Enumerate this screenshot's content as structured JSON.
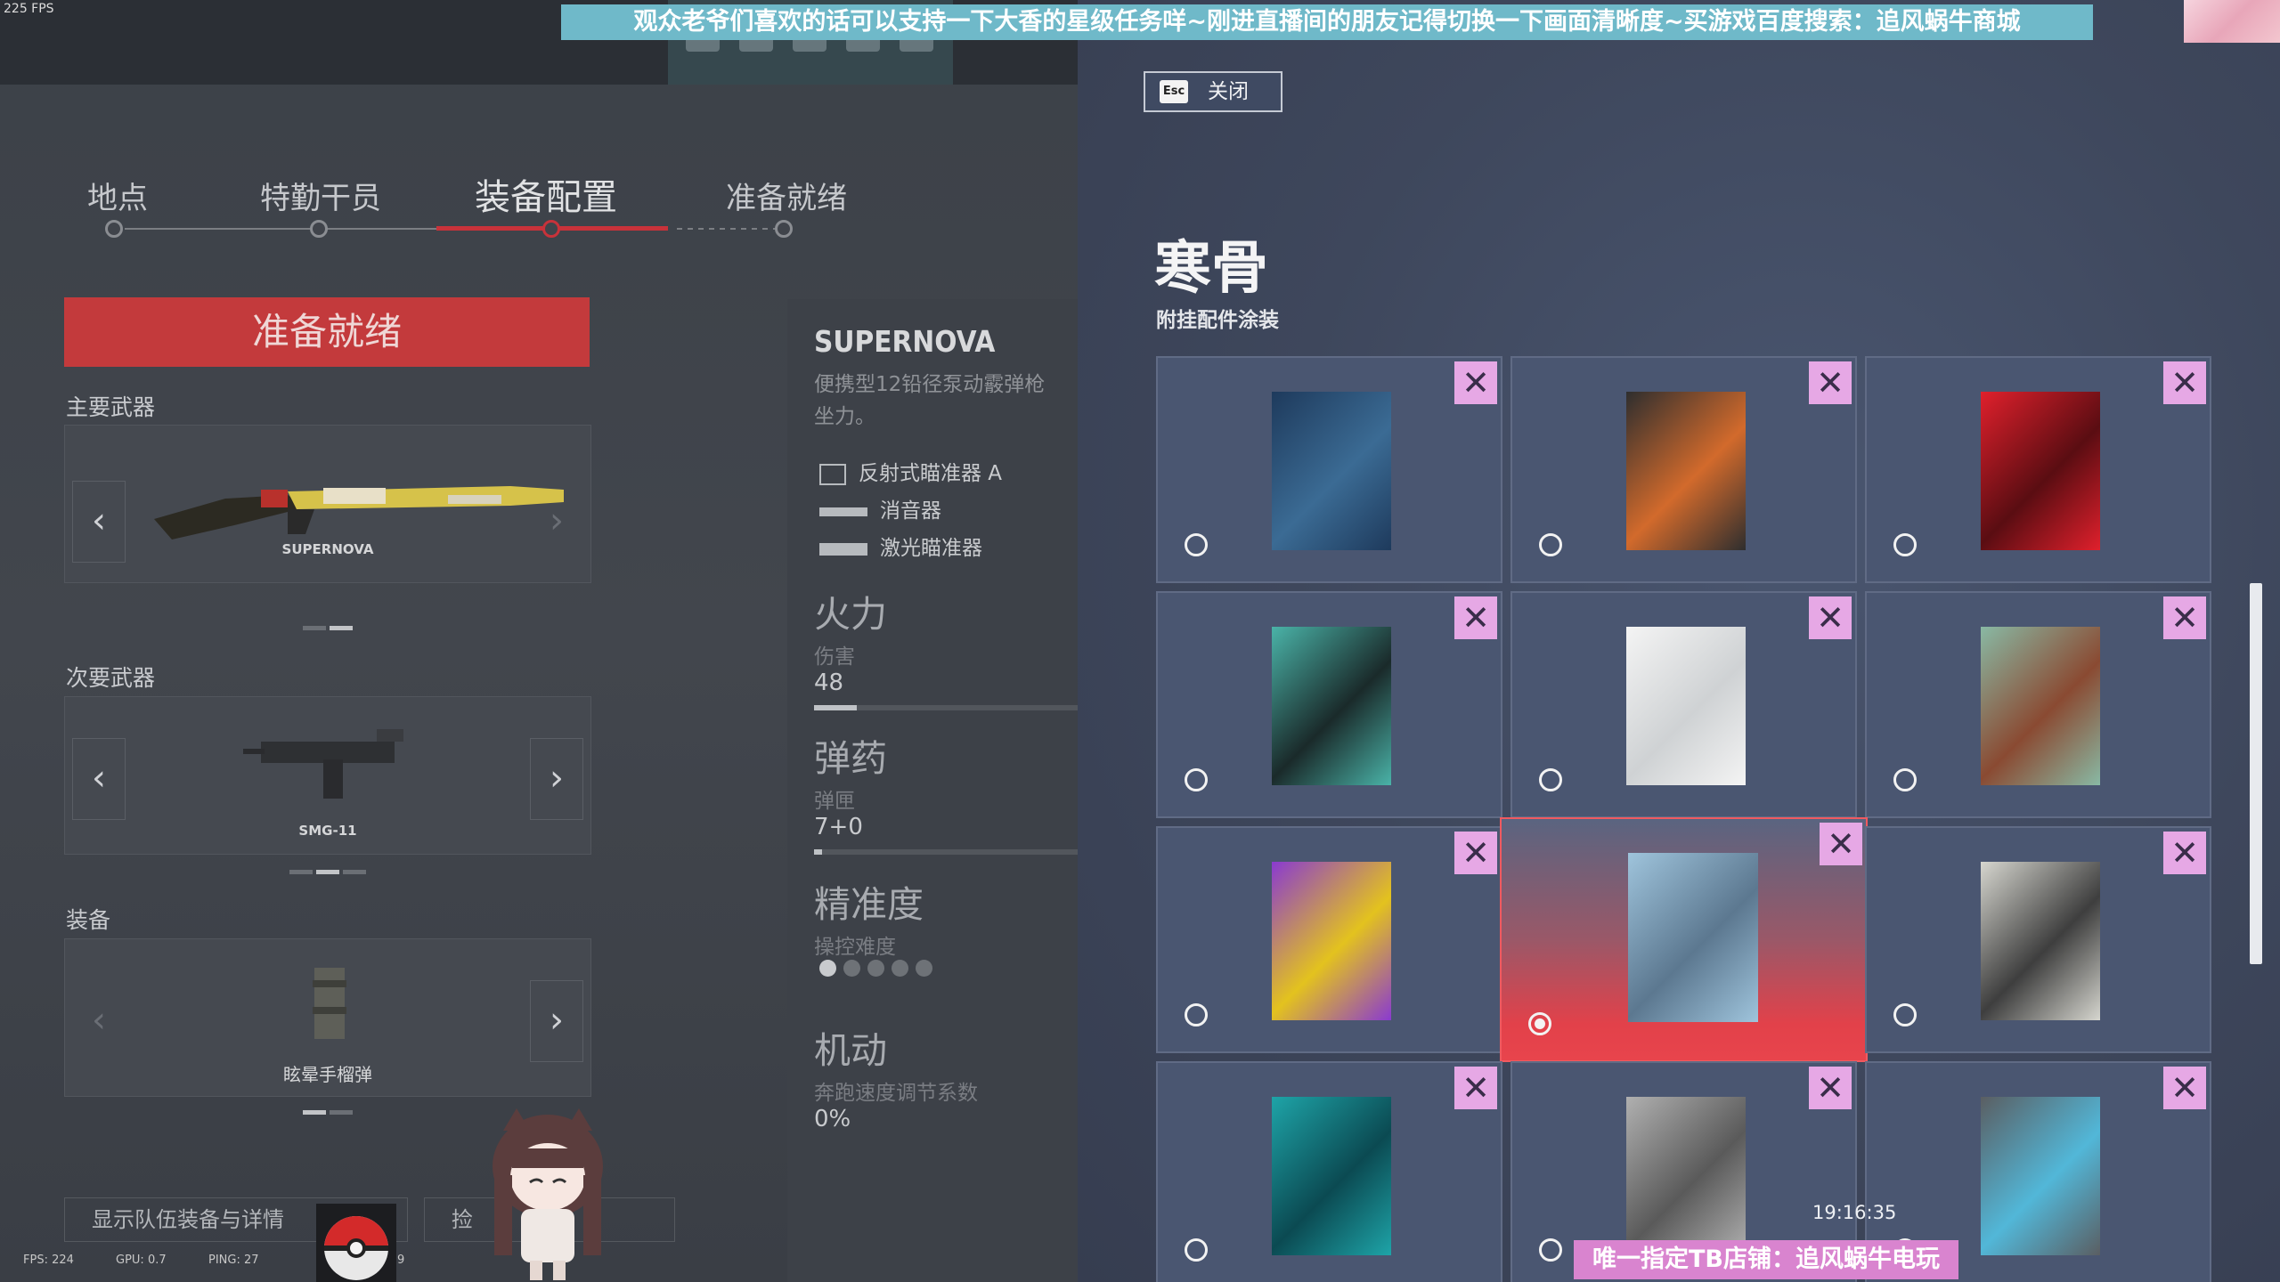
{
  "overlay": {
    "fps_top": "225 FPS",
    "banner_top": "观众老爷们喜欢的话可以支持一下大香的星级任务咩~刚进直播间的朋友记得切换一下画面清晰度~买游戏百度搜索：追风蜗牛商城",
    "banner_bottom": "唯一指定TB店铺：追风蜗牛电玩",
    "clock": "19:16:35",
    "perf": {
      "fps": "FPS: 224",
      "gpu": "GPU: 0.7",
      "ping": "PING: 27",
      "extra": "9"
    }
  },
  "steps": [
    {
      "label": "地点",
      "active": false
    },
    {
      "label": "特勤干员",
      "active": false
    },
    {
      "label": "装备配置",
      "active": true
    },
    {
      "label": "准备就绪",
      "active": false
    }
  ],
  "left": {
    "ready_button": "准备就绪",
    "primary_label": "主要武器",
    "primary_weapon": "SUPERNOVA",
    "secondary_label": "次要武器",
    "secondary_weapon": "SMG-11",
    "gadget_label": "装备",
    "gadget": "眩晕手榴弹",
    "show_team_button": "显示队伍装备与详情",
    "second_button": "捡"
  },
  "detail": {
    "title": "SUPERNOVA",
    "desc_line1": "便携型12铅径泵动霰弹枪",
    "desc_line2": "坐力。",
    "attachments": [
      "反射式瞄准器 A",
      "消音器",
      "激光瞄准器"
    ],
    "stats": [
      {
        "heading": "火力",
        "sub": "伤害",
        "value": "48",
        "level": 0.16
      },
      {
        "heading": "弹药",
        "sub": "弹匣",
        "value": "7+0",
        "level": 0.03
      },
      {
        "heading": "精准度",
        "sub": "操控难度",
        "dots_on": 1,
        "dots_total": 5
      },
      {
        "heading": "机动",
        "sub": "奔跑速度调节系数",
        "value": "0%"
      }
    ]
  },
  "skins": {
    "close_key": "Esc",
    "close_label": "关闭",
    "title": "寒骨",
    "subtitle": "附挂配件涂装",
    "selected_index": 7,
    "tiles": [
      {
        "name": "blue-carved-skin",
        "colors": [
          "#1e3a5c",
          "#3b6b94"
        ]
      },
      {
        "name": "charcoal-lava-skin",
        "colors": [
          "#2e2e2e",
          "#d26a2c"
        ]
      },
      {
        "name": "red-skull-skin",
        "colors": [
          "#e0202c",
          "#5a0d12"
        ]
      },
      {
        "name": "teal-stained-glass-skin",
        "colors": [
          "#4ab3a8",
          "#1a2a2a"
        ]
      },
      {
        "name": "white-frost-skin",
        "colors": [
          "#f4f4f4",
          "#cfd2d4"
        ]
      },
      {
        "name": "copper-pipe-skin",
        "colors": [
          "#89b9a4",
          "#8a4a32"
        ]
      },
      {
        "name": "feather-yellow-purple-skin",
        "colors": [
          "#8a3ad0",
          "#e3c21e"
        ]
      },
      {
        "name": "chrome-skull-skin",
        "colors": [
          "#9fc4dc",
          "#5c7890"
        ]
      },
      {
        "name": "raccoon-comic-skin",
        "colors": [
          "#d6d6cf",
          "#3e3e3e"
        ]
      },
      {
        "name": "teal-drip-skin",
        "colors": [
          "#1ea4a8",
          "#0b4a52"
        ]
      },
      {
        "name": "silver-wave-skin",
        "colors": [
          "#b0b0b0",
          "#5a5a5a"
        ]
      },
      {
        "name": "blue-rune-stone-skin",
        "colors": [
          "#5a5e62",
          "#52b7d8"
        ]
      }
    ]
  }
}
